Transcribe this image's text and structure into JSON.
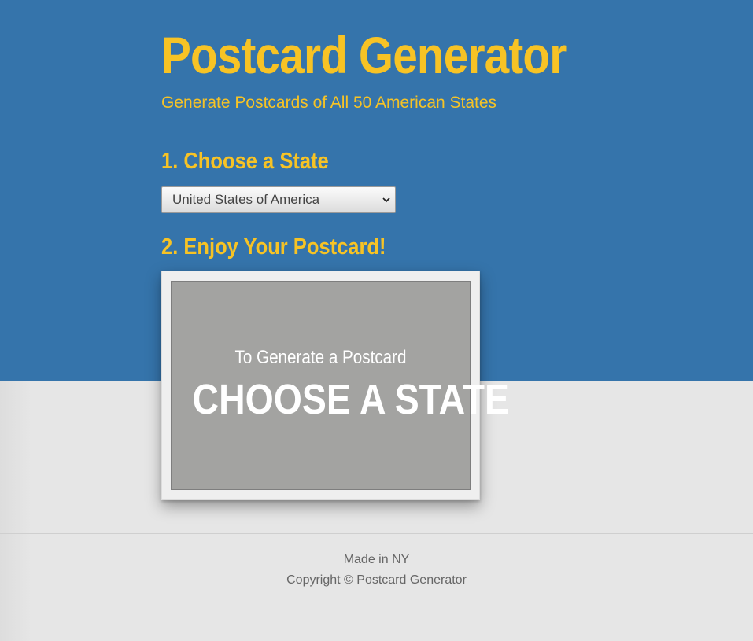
{
  "header": {
    "title": "Postcard Generator",
    "subtitle": "Generate Postcards of All 50 American States"
  },
  "steps": {
    "choose_heading": "1. Choose a State",
    "enjoy_heading": "2. Enjoy Your Postcard!"
  },
  "state_select": {
    "selected": "United States of America",
    "icon": "chevron-down-icon"
  },
  "postcard": {
    "line1": "To Generate a Postcard",
    "line2": "CHOOSE A STATE"
  },
  "footer": {
    "made_in": "Made in NY",
    "copyright": "Copyright © Postcard Generator"
  },
  "colors": {
    "header_bg": "#3574ab",
    "accent": "#f7c325",
    "page_bg": "#e6e6e6",
    "postcard_fill": "#a3a3a1"
  }
}
